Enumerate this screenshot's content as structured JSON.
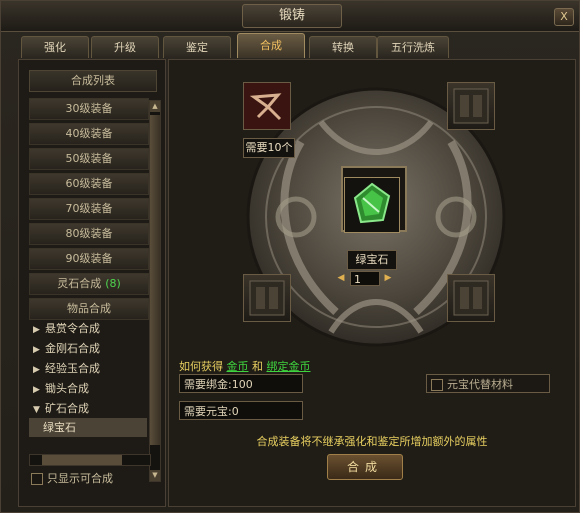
{
  "window": {
    "title": "锻铸",
    "close": "X"
  },
  "tabs": [
    {
      "label": "强化",
      "active": false
    },
    {
      "label": "升级",
      "active": false
    },
    {
      "label": "鉴定",
      "active": false
    },
    {
      "label": "合成",
      "active": true
    },
    {
      "label": "转换",
      "active": false
    },
    {
      "label": "五行洗炼",
      "active": false
    }
  ],
  "sidebar": {
    "header": "合成列表",
    "categories": [
      {
        "label": "30级装备"
      },
      {
        "label": "40级装备"
      },
      {
        "label": "50级装备"
      },
      {
        "label": "60级装备"
      },
      {
        "label": "70级装备"
      },
      {
        "label": "80级装备"
      },
      {
        "label": "90级装备"
      },
      {
        "label": "灵石合成",
        "badge": "(8)"
      },
      {
        "label": "物品合成"
      }
    ],
    "tree": [
      {
        "label": "悬赏令合成",
        "arrow": "▶"
      },
      {
        "label": "金刚石合成",
        "arrow": "▶"
      },
      {
        "label": "经验玉合成",
        "arrow": "▶"
      },
      {
        "label": "锄头合成",
        "arrow": "▶"
      },
      {
        "label": "矿石合成",
        "arrow": "▼"
      }
    ],
    "selected_leaf": "绿宝石",
    "only_composable_label": "只显示可合成",
    "only_composable_checked": false
  },
  "compose": {
    "required_material_label": "需要10个",
    "target_item_label": "绿宝石",
    "quantity": "1",
    "howto_prefix": "如何获得",
    "howto_link1": "金币",
    "howto_and": "和",
    "howto_link2": "绑定金币",
    "need_bound_gold": "需要绑金:100",
    "need_yuanbao": "需要元宝:0",
    "yuanbao_substitute_label": "元宝代替材料",
    "yuanbao_substitute_checked": false,
    "notice": "合成装备将不继承强化和鉴定所增加额外的属性",
    "compose_button": "合成"
  },
  "colors": {
    "accent_gold": "#e8d060",
    "link_green": "#3ed43e",
    "gem_green": "#3ec83e"
  }
}
